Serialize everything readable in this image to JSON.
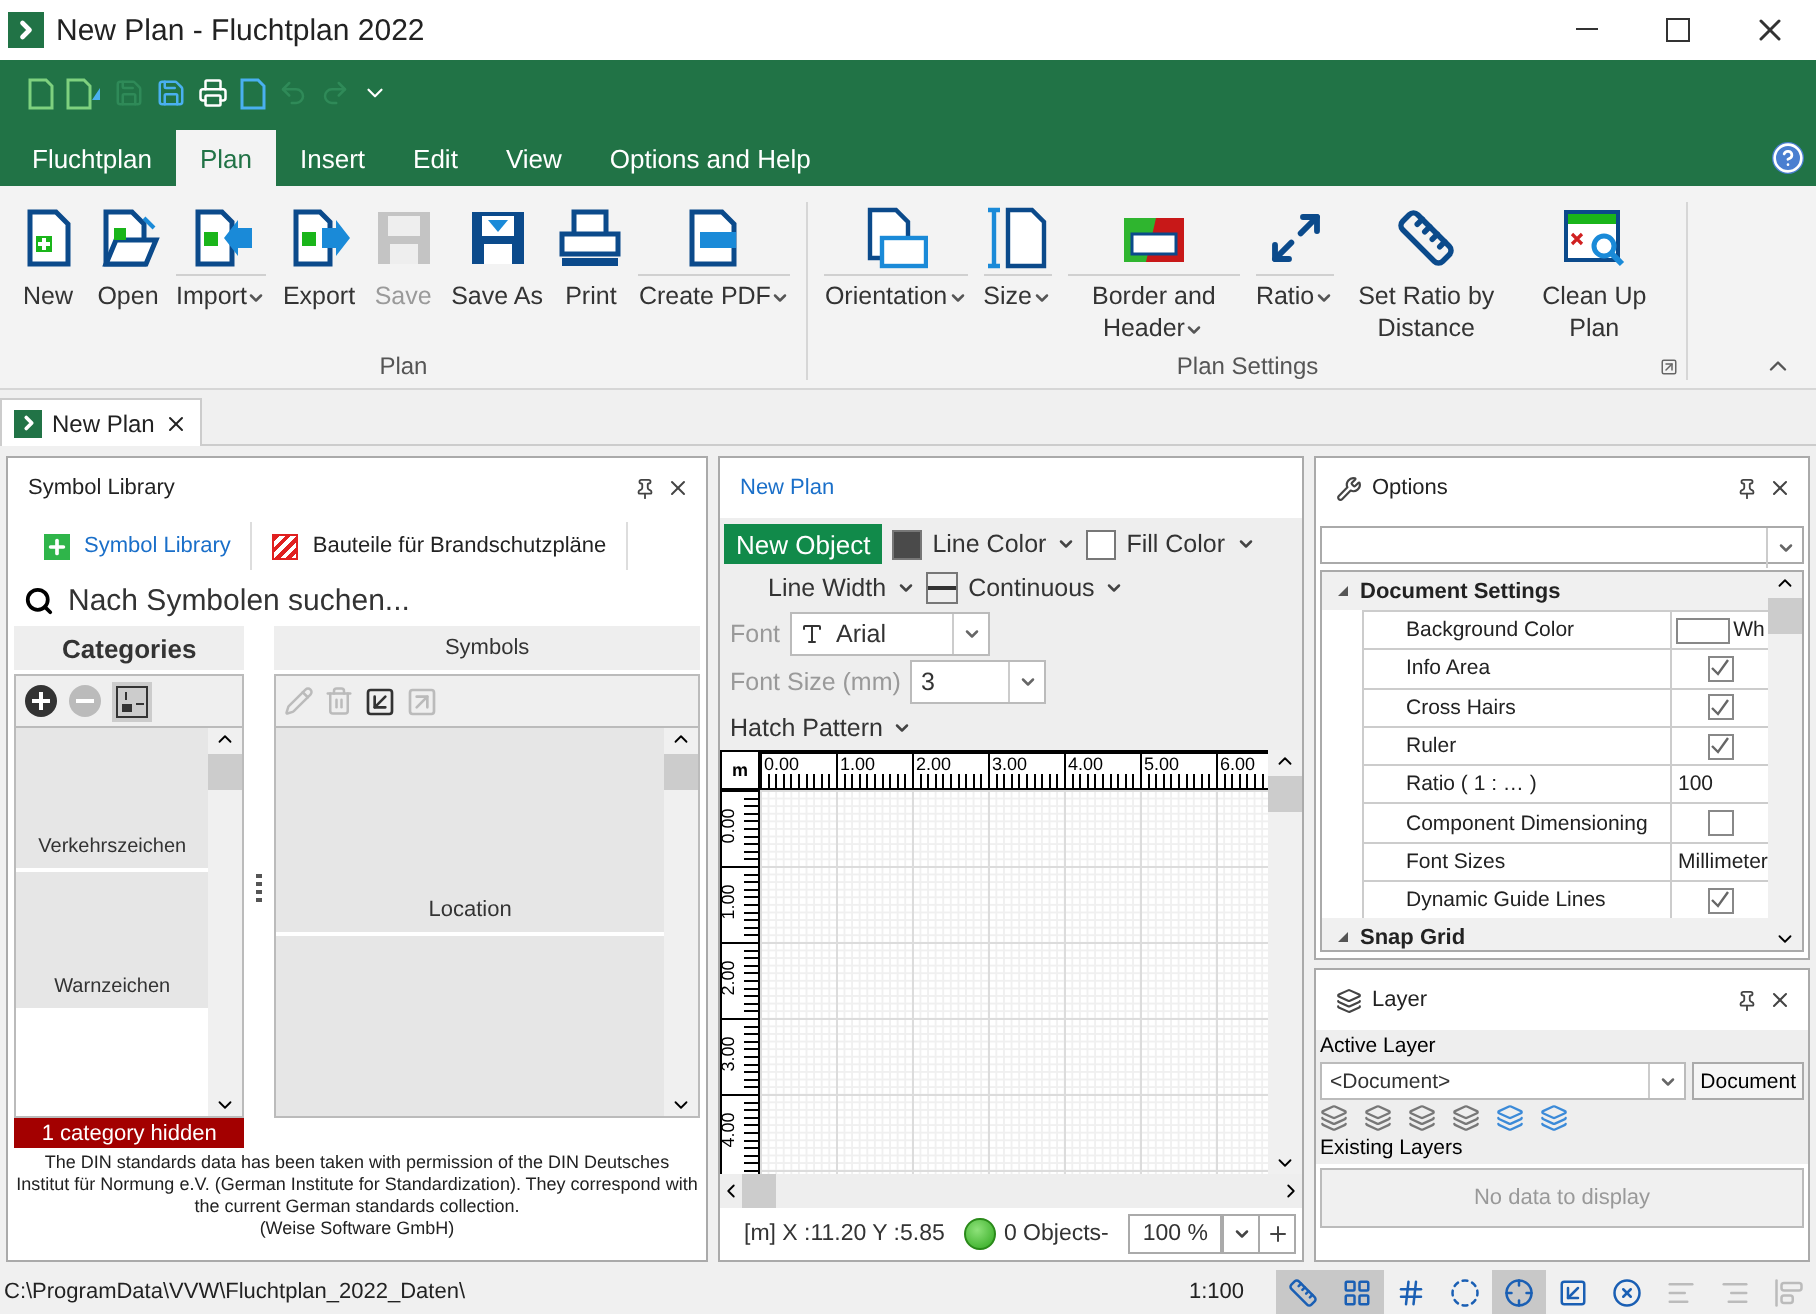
{
  "window": {
    "title": "New Plan - Fluchtplan 2022"
  },
  "ribbon_tabs": [
    {
      "label": "Fluchtplan",
      "selected": false
    },
    {
      "label": "Plan",
      "selected": true
    },
    {
      "label": "Insert",
      "selected": false
    },
    {
      "label": "Edit",
      "selected": false
    },
    {
      "label": "View",
      "selected": false
    },
    {
      "label": "Options and Help",
      "selected": false
    }
  ],
  "ribbon_groups": [
    {
      "label": "Plan",
      "launcher": false,
      "buttons": [
        {
          "kind": "new",
          "label": "New",
          "dropdown": false,
          "disabled": false
        },
        {
          "kind": "open",
          "label": "Open",
          "dropdown": false,
          "disabled": false
        },
        {
          "kind": "import",
          "label": "Import",
          "dropdown": true,
          "disabled": false
        },
        {
          "kind": "export",
          "label": "Export",
          "dropdown": false,
          "disabled": false
        },
        {
          "kind": "save",
          "label": "Save",
          "dropdown": false,
          "disabled": true
        },
        {
          "kind": "save-as",
          "label": "Save As",
          "dropdown": false,
          "disabled": false
        },
        {
          "kind": "print",
          "label": "Print",
          "dropdown": false,
          "disabled": false
        },
        {
          "kind": "pdf",
          "label": "Create PDF",
          "dropdown": true,
          "disabled": false
        }
      ]
    },
    {
      "label": "Plan Settings",
      "launcher": true,
      "buttons": [
        {
          "kind": "orientation",
          "label": "Orientation",
          "dropdown": true,
          "disabled": false
        },
        {
          "kind": "size",
          "label": "Size",
          "dropdown": true,
          "disabled": false
        },
        {
          "kind": "border",
          "label": "Border and Header",
          "dropdown": true,
          "disabled": false
        },
        {
          "kind": "ratio",
          "label": "Ratio",
          "dropdown": true,
          "disabled": false
        },
        {
          "kind": "ratio-distance",
          "label": "Set Ratio by Distance",
          "dropdown": false,
          "disabled": false
        },
        {
          "kind": "cleanup",
          "label": "Clean Up Plan",
          "dropdown": false,
          "disabled": false
        }
      ]
    }
  ],
  "document_tabs": [
    {
      "label": "New Plan",
      "selected": true
    }
  ],
  "symbol_library": {
    "title": "Symbol Library",
    "tabs": [
      {
        "kind": "library",
        "label": "Symbol Library",
        "selected": true
      },
      {
        "kind": "fire",
        "label": "Bauteile für Brandschutzpläne",
        "selected": false
      }
    ],
    "search_placeholder": "Nach Symbolen suchen...",
    "categories_header": "Categories",
    "symbols_header": "Symbols",
    "categories": [
      "Verkehrszeichen",
      "Warnzeichen"
    ],
    "symbols": [
      "Location"
    ],
    "hidden_notice": "1 category hidden",
    "footer": [
      "The DIN standards data has been taken with permission of the DIN Deutsches Institut für Normung e.V. (German Institute for Standardization). They correspond with the current German standards collection.",
      "(Weise Software GmbH)"
    ]
  },
  "plan_panel": {
    "title": "New Plan",
    "new_object": "New Object",
    "line_color": {
      "label": "Line Color",
      "color": "#4a4a4a"
    },
    "fill_color": {
      "label": "Fill Color",
      "color": "#ffffff"
    },
    "line_width": "Line Width",
    "line_style": "Continuous",
    "font": {
      "label": "Font",
      "value": "Arial",
      "disabled": true
    },
    "font_size": {
      "label": "Font Size (mm)",
      "value": "3",
      "disabled": true
    },
    "hatch": "Hatch Pattern",
    "ruler_unit": "m",
    "x_ticks": [
      "0.00",
      "1.00",
      "2.00",
      "3.00",
      "4.00",
      "5.00",
      "6.00"
    ],
    "y_ticks": [
      "0.00",
      "1.00",
      "2.00",
      "3.00",
      "4.00"
    ],
    "coords": "[m] X :11.20 Y :5.85",
    "objects": "0 Objects-",
    "zoom": "100 %"
  },
  "options": {
    "title": "Options",
    "sections": [
      {
        "label": "Document Settings",
        "expanded": true,
        "rows": [
          {
            "kind": "color",
            "label": "Background Color",
            "value": "Wh"
          },
          {
            "kind": "check",
            "label": "Info Area",
            "checked": true
          },
          {
            "kind": "check",
            "label": "Cross Hairs",
            "checked": true
          },
          {
            "kind": "check",
            "label": "Ruler",
            "checked": true
          },
          {
            "kind": "text",
            "label": "Ratio ( 1 : … )",
            "value": "100"
          },
          {
            "kind": "check",
            "label": "Component Dimensioning",
            "checked": false
          },
          {
            "kind": "text",
            "label": "Font Sizes",
            "value": "Millimeter"
          },
          {
            "kind": "check",
            "label": "Dynamic Guide Lines",
            "checked": true
          }
        ]
      },
      {
        "label": "Snap Grid",
        "expanded": true
      }
    ]
  },
  "layer": {
    "title": "Layer",
    "active_label": "Active Layer",
    "active_value": "<Document>",
    "document_button": "Document",
    "existing_label": "Existing Layers",
    "empty": "No data to display"
  },
  "status_bar": {
    "path": "C:\\ProgramData\\VVW\\Fluchtplan_2022_Daten\\",
    "scale": "1:100",
    "tools": [
      {
        "kind": "angle",
        "selected": true,
        "disabled": false
      },
      {
        "kind": "grid",
        "selected": true,
        "disabled": false
      },
      {
        "kind": "snap-grid",
        "selected": false,
        "disabled": false
      },
      {
        "kind": "dots",
        "selected": false,
        "disabled": false
      },
      {
        "kind": "snap-line",
        "selected": true,
        "disabled": false
      },
      {
        "kind": "insert",
        "selected": false,
        "disabled": false
      },
      {
        "kind": "cross",
        "selected": false,
        "disabled": false
      },
      {
        "kind": "align-left",
        "selected": false,
        "disabled": true
      },
      {
        "kind": "align-right",
        "selected": false,
        "disabled": true
      },
      {
        "kind": "align-top",
        "selected": false,
        "disabled": true
      }
    ]
  }
}
